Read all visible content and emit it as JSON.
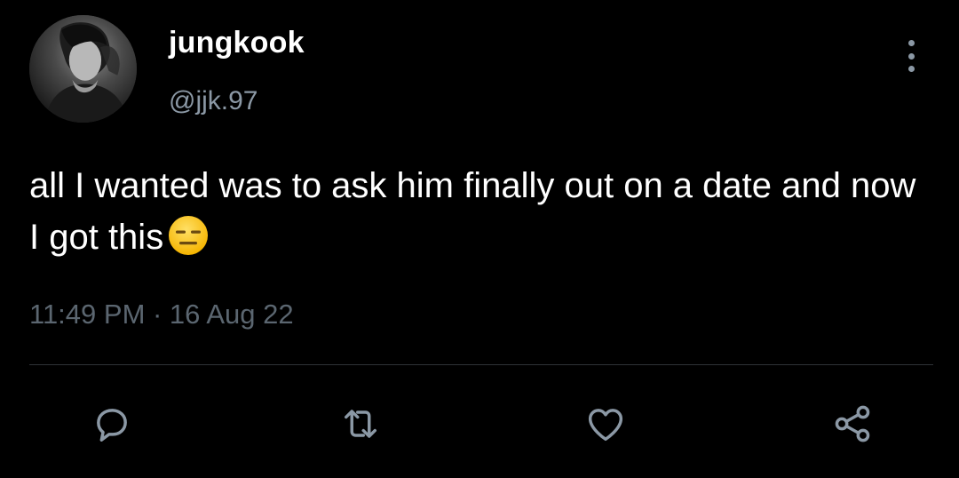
{
  "tweet": {
    "author": {
      "display_name": "jungkook",
      "handle": "@jjk.97"
    },
    "text": "all I wanted was to ask him finally out on a date and now I got this",
    "emoji": "expressionless-face",
    "timestamp": "11:49 PM · 16 Aug 22"
  },
  "actions": [
    "reply-icon",
    "retweet-icon",
    "like-icon",
    "share-icon"
  ],
  "colors": {
    "background": "#000000",
    "primary_text": "#ffffff",
    "secondary_text": "#8b98a5",
    "timestamp_text": "#5b6670",
    "divider": "#2f3336"
  }
}
